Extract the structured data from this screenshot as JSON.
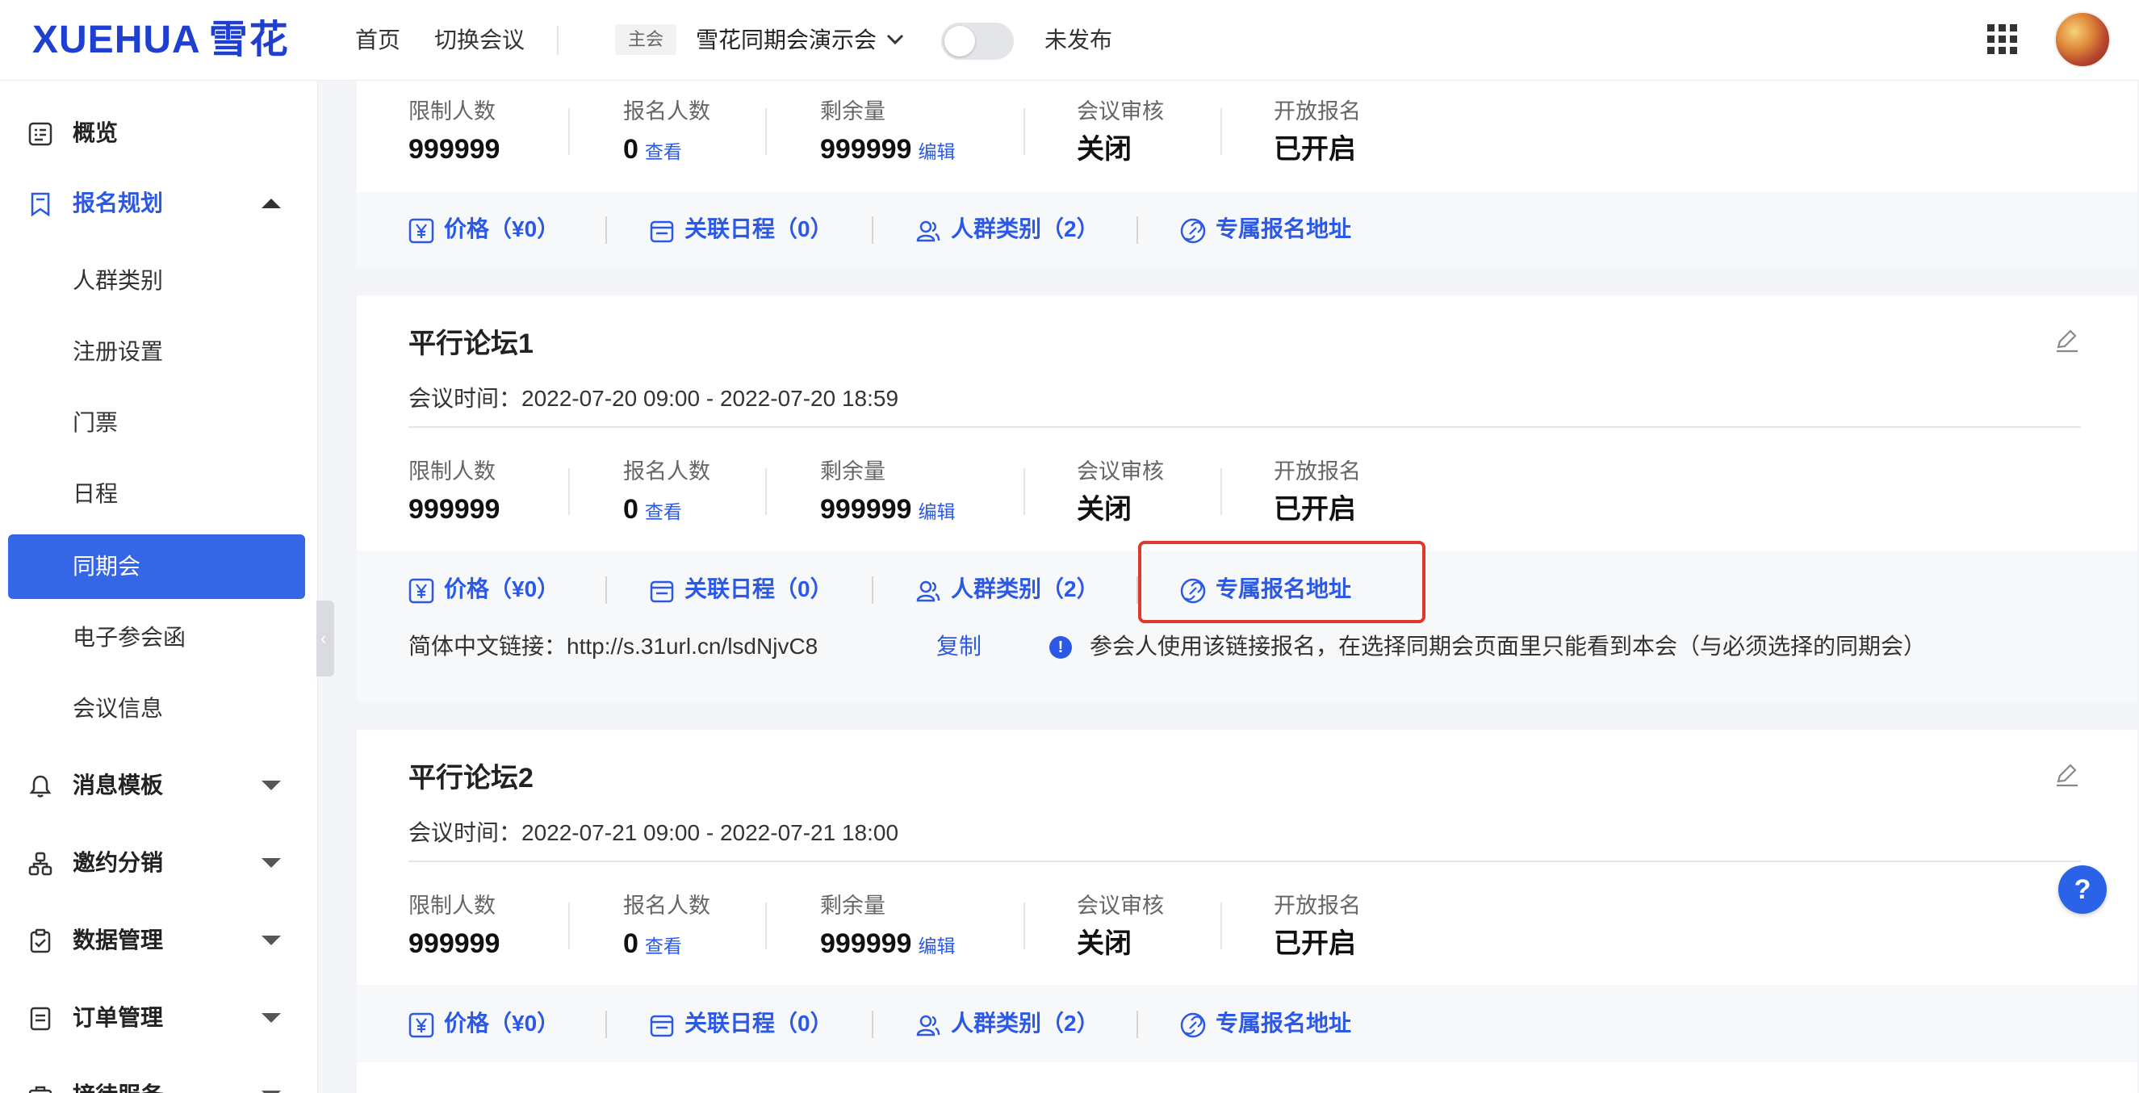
{
  "topbar": {
    "logo_en": "XUEHUA",
    "logo_zh": "雪花",
    "nav": [
      "首页",
      "切换会议"
    ],
    "main_tag": "主会",
    "conference_name": "雪花同期会演示会",
    "publish_status": "未发布"
  },
  "sidebar": {
    "overview": "概览",
    "registration": "报名规划",
    "sub_items": [
      "人群类别",
      "注册设置",
      "门票",
      "日程",
      "同期会",
      "电子参会函",
      "会议信息"
    ],
    "active_sub": "同期会",
    "menus": [
      "消息模板",
      "邀约分销",
      "数据管理",
      "订单管理",
      "接待服务"
    ]
  },
  "labels": {
    "limit": "限制人数",
    "registered": "报名人数",
    "remaining": "剩余量",
    "review": "会议审核",
    "open": "开放报名",
    "view": "查看",
    "edit": "编辑",
    "price": "价格（¥0）",
    "schedule": "关联日程（0）",
    "crowd": "人群类别（2）",
    "exclusive": "专属报名地址"
  },
  "cards": [
    {
      "title": "",
      "time": "",
      "limit": "999999",
      "registered": "0",
      "remaining": "999999",
      "review": "关闭",
      "open": "已开启"
    },
    {
      "title": "平行论坛1",
      "time": "会议时间：2022-07-20 09:00 - 2022-07-20 18:59",
      "limit": "999999",
      "registered": "0",
      "remaining": "999999",
      "review": "关闭",
      "open": "已开启",
      "link_label": "简体中文链接：http://s.31url.cn/lsdNjvC8",
      "copy": "复制",
      "link_note": "参会人使用该链接报名，在选择同期会页面里只能看到本会（与必须选择的同期会）"
    },
    {
      "title": "平行论坛2",
      "time": "会议时间：2022-07-21 09:00 - 2022-07-21 18:00",
      "limit": "999999",
      "registered": "0",
      "remaining": "999999",
      "review": "关闭",
      "open": "已开启"
    }
  ],
  "help": "?",
  "colors": {
    "primary": "#2b59e6",
    "highlight": "#e0392b",
    "active_bg": "#3566e6"
  }
}
